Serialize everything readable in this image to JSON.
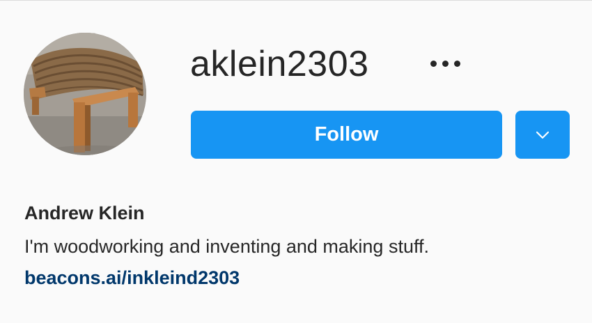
{
  "profile": {
    "username": "aklein2303",
    "full_name": "Andrew Klein",
    "bio": "I'm woodworking and inventing and making stuff.",
    "link": "beacons.ai/inkleind2303"
  },
  "actions": {
    "follow_label": "Follow",
    "more_icon": "more-horizontal-icon",
    "dropdown_icon": "chevron-down-icon"
  },
  "colors": {
    "primary_button": "#1795f3",
    "link": "#00376b",
    "text": "#262626",
    "background": "#fafafa"
  },
  "avatar": {
    "subject": "wooden-chair-photo"
  }
}
